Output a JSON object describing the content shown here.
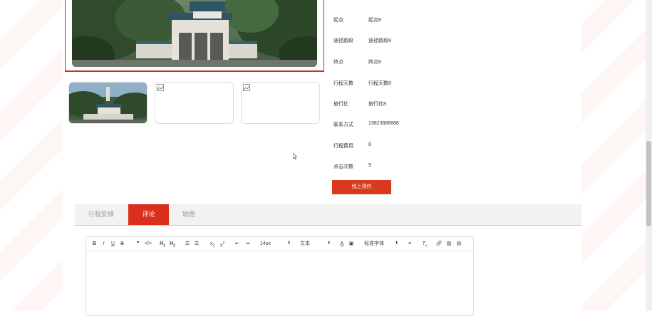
{
  "info_rows": [
    {
      "label": "起点",
      "value": "起点8"
    },
    {
      "label": "途径路段",
      "value": "途径路段8"
    },
    {
      "label": "终点",
      "value": "终点8"
    },
    {
      "label": "行程天数",
      "value": "行程天数8"
    },
    {
      "label": "旅行社",
      "value": "旅行社8"
    },
    {
      "label": "联系方式",
      "value": "13823888888"
    },
    {
      "label": "行程费用",
      "value": "8"
    },
    {
      "label": "点击次数",
      "value": "9"
    }
  ],
  "book_button": "线上预约",
  "tabs": [
    {
      "label": "行程安排",
      "active": false
    },
    {
      "label": "评论",
      "active": true
    },
    {
      "label": "地图",
      "active": false
    }
  ],
  "editor": {
    "font_size": "14px",
    "text_style": "文本",
    "font_family": "标准字体"
  },
  "colors": {
    "accent": "#d9301c",
    "button": "#d93a1e",
    "frame_border": "#c8321e"
  }
}
